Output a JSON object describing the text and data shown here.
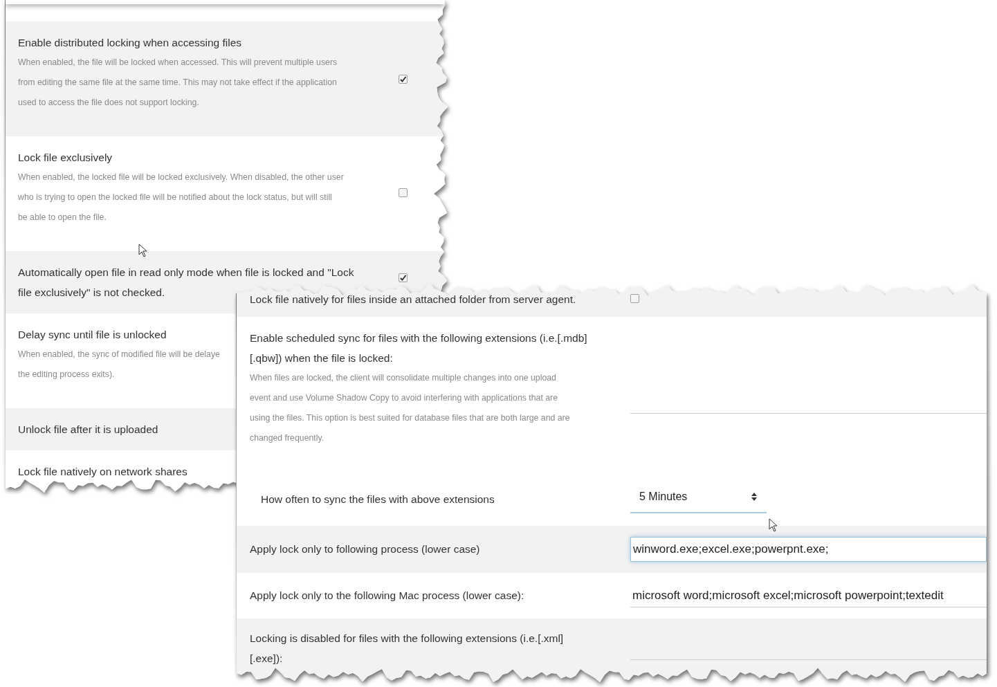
{
  "left_panel": {
    "rows": [
      {
        "label_lines": [
          "Enable distributed locking when accessing files"
        ],
        "description_lines": [
          "When enabled, the file will be locked when accessed. This will prevent multiple users",
          "from editing the same file at the same time. This may not take effect if the application",
          "used to access the file does not support locking."
        ],
        "checked": true
      },
      {
        "label_lines": [
          "Lock file exclusively"
        ],
        "description_lines": [
          "When enabled, the locked file will be locked exclusively. When disabled, the other user",
          "who is trying to open the locked file will be notified about the lock status, but will still",
          "be able to open the file."
        ],
        "checked": false
      },
      {
        "label_lines": [
          "Automatically open file in read only mode when file is locked and \"Lock",
          "file exclusively\" is not checked."
        ],
        "checked": true
      },
      {
        "label_lines": [
          "Delay sync until file is unlocked"
        ],
        "description_lines": [
          "When enabled, the sync of modified file will be delaye",
          "the editing process exits)."
        ]
      },
      {
        "label_lines": [
          "Unlock file after it is uploaded"
        ]
      },
      {
        "label_lines": [
          "Lock file natively on network shares"
        ]
      }
    ]
  },
  "right_panel": {
    "rows": [
      {
        "kind": "checkbox",
        "label_lines": [
          "Lock file natively for files inside an attached folder from server agent."
        ],
        "checked": false
      },
      {
        "kind": "text",
        "label_lines": [
          "Enable scheduled sync for files with the following extensions (i.e.[.mdb]",
          "[.qbw]) when the file is locked:"
        ],
        "description_lines": [
          "When files are locked, the client will consolidate multiple changes into one upload",
          "event and use Volume Shadow Copy to avoid interfering with applications that are",
          "using the files. This option is best suited for database files that are both large and are",
          "changed frequently."
        ],
        "focused": false,
        "sub_setting": {
          "label": "How often to sync the files with above extensions",
          "value": "5 Minutes"
        }
      },
      {
        "kind": "text",
        "label_lines": [
          "Apply lock only to following process (lower case)"
        ],
        "value": "winword.exe;excel.exe;powerpnt.exe;",
        "focused": true
      },
      {
        "kind": "text",
        "label_lines": [
          "Apply lock only to the following Mac process (lower case):"
        ],
        "value": "microsoft word;microsoft excel;microsoft powerpoint;textedit",
        "focused": false
      },
      {
        "kind": "text",
        "label_lines": [
          "Locking is disabled for files with the following extensions (i.e.[.xml]",
          "[.exe]):"
        ],
        "focused": false
      }
    ]
  }
}
